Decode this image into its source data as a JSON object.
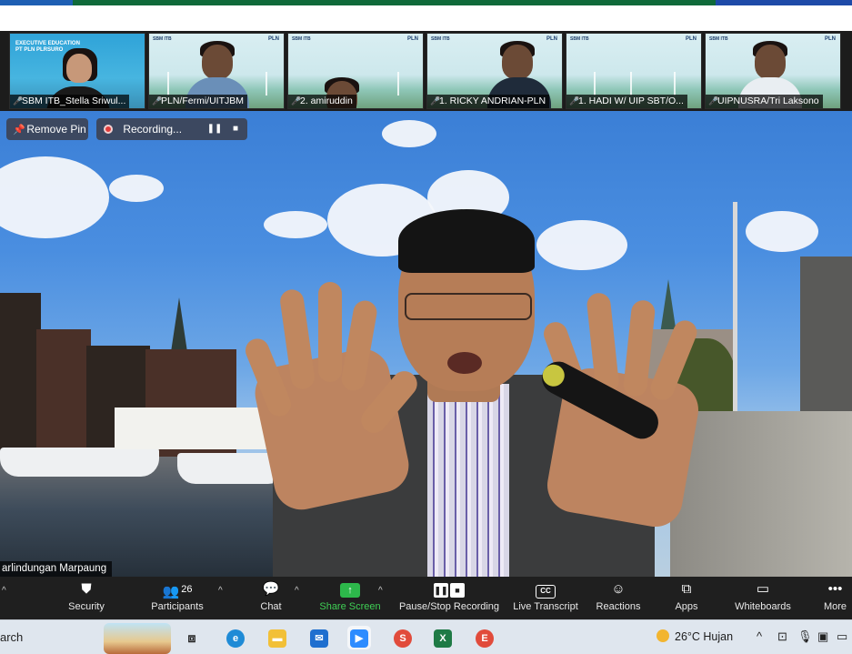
{
  "gallery": {
    "participants": [
      {
        "name": "SBM ITB_Stella Sriwul...",
        "banner": "EXECUTIVE EDUCATION\nPT PLN PLRSURO"
      },
      {
        "name": "PLN/Fermi/UITJBM",
        "banner": ""
      },
      {
        "name": "2. amiruddin",
        "banner": ""
      },
      {
        "name": "1. RICKY ANDRIAN-PLN",
        "banner": ""
      },
      {
        "name": "1. HADI W/ UIP SBT/O...",
        "banner": ""
      },
      {
        "name": "UIPNUSRA/Tri Laksono",
        "banner": ""
      }
    ],
    "brand_small": "SBM ITB",
    "logo_small": "PLN"
  },
  "video_controls": {
    "remove_pin_label": "Remove Pin",
    "recording_label": "Recording...",
    "pause_symbol": "❚❚",
    "stop_symbol": "■"
  },
  "speaker": {
    "name": "arlindungan Marpaung"
  },
  "toolbar": {
    "security": "Security",
    "participants": "Participants",
    "participant_count": "26",
    "chat": "Chat",
    "share_screen": "Share Screen",
    "pause_stop_recording": "Pause/Stop Recording",
    "live_transcript": "Live Transcript",
    "cc_text": "CC",
    "reactions": "Reactions",
    "apps": "Apps",
    "whiteboards": "Whiteboards",
    "more": "More",
    "accent_color": "#3fcf55"
  },
  "taskbar": {
    "search_text": "arch",
    "weather": "26°C  Hujan",
    "apps": [
      "task-view",
      "edge",
      "file-explorer",
      "mail",
      "zoom",
      "chrome-s",
      "excel",
      "chrome-e"
    ]
  }
}
